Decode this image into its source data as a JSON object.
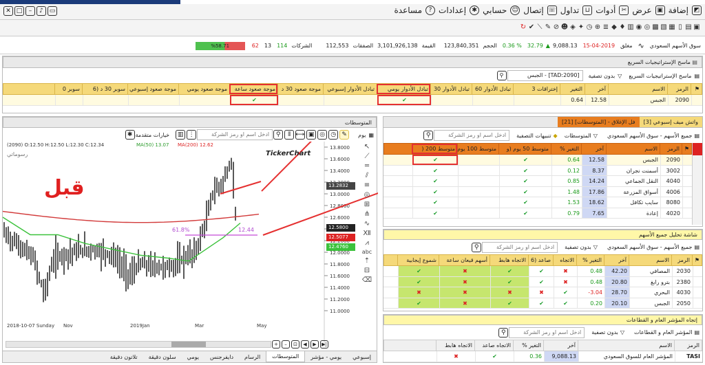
{
  "top_menu": [
    "مساعدة",
    "إعدادات",
    "حسابي",
    "إتصال",
    "تداول",
    "أدوات",
    "عرض",
    "إضافة"
  ],
  "market": {
    "name": "سوق الأسهم السعودي",
    "status": "مغلق",
    "date": "15-04-2019",
    "index": "9,088.13",
    "change": "32.79",
    "change_pct": "% 0.36",
    "volume_label": "الحجم",
    "volume": "123,840,351",
    "value_label": "القيمة",
    "value": "3,101,926,138",
    "deals_label": "الصفقات",
    "deals": "112,553",
    "companies_label": "الشركات",
    "up": "114",
    "unchanged": "13",
    "down": "62",
    "ratio": "%58.71"
  },
  "strategy": {
    "title": "ماسح الإستراتيجيات السريع",
    "scanner_btn": "ماسح الإستراتيجيات السريع",
    "filter_btn": "بدون تصفية",
    "symbol_field": "[TAD:2090] - الجبس",
    "headers": [
      "الرمز",
      "الاسم",
      "آخر",
      "التغير",
      "إختراقات 3",
      "تبادل الأدوار 60",
      "تبادل الأدوار 30",
      "تبادل الأدوار يومي",
      "تبادل الأدوار إسبوعي",
      "موجة صعود 30 د",
      "موجة صعود ساعة",
      "موجة صعود يومي",
      "موجة صعود إسبوعي",
      "سوبر 30 د (6",
      "سوبر 0"
    ],
    "row": {
      "code": "2090",
      "name": "الجبس",
      "last": "12.58",
      "change": "0.64"
    }
  },
  "chart": {
    "title": "المتوسطات",
    "period": "يوم",
    "advanced": "خيارات متقدمة",
    "search_placeholder": "ادخل اسم او رمز الشركة",
    "info": "(2090) O:12.50 H:12.50 L:12.30 C:12.34",
    "ma50": "MA(50) 13.07",
    "ma200": "MA(200) 12.62",
    "drawings": "رسوماتي",
    "brand": "TickerChart",
    "before": "قبل",
    "fib_label": "61.8%",
    "fib_value": "12.44",
    "y_ticks": [
      "13.8000",
      "13.6000",
      "13.4000",
      "13.2000",
      "13.0000",
      "12.8000",
      "12.6000",
      "12.4000",
      "12.2000",
      "12.0000",
      "11.8000",
      "11.6000",
      "11.4000",
      "11.2000",
      "11.0000"
    ],
    "price_tags": [
      "13.2832",
      "12.5800",
      "12.5077",
      "12.4760"
    ],
    "x_ticks": [
      "2018-10-07 Sunday",
      "Nov",
      "2019Jan",
      "Mar",
      "May"
    ]
  },
  "tabs": [
    "إسبوعي",
    "يومي - مؤشر",
    "المتوسطات",
    "الرسام",
    "دايفرجنس",
    "يومي",
    "سلون دقيقة",
    "تلاتون دقيقة"
  ],
  "watch": {
    "title": "واتش ميف إسبوعي [3]",
    "title2": "فل الإغلاق - [المتوسطات] [21]",
    "market_label": "جميع الأسهم - سوق الأسهم السعودي",
    "averages_btn": "المتوسطات",
    "alerts_btn": "تنبيهات التصفية",
    "search_placeholder": "ادخل اسم او رمز الشركة",
    "headers": [
      "الرمز",
      "الاسم",
      "آخر",
      "التغير %",
      "متوسط 50 يوم (و",
      "متوسط 100 يوم",
      "متوسط 200 ("
    ],
    "rows": [
      {
        "code": "2090",
        "name": "الجبس",
        "last": "12.58",
        "chg": "0.64"
      },
      {
        "code": "3002",
        "name": "أسمنت نجران",
        "last": "8.37",
        "chg": "0.12"
      },
      {
        "code": "4040",
        "name": "النقل الجماعي",
        "last": "14.24",
        "chg": "0.85"
      },
      {
        "code": "4006",
        "name": "أسواق المزرعة",
        "last": "17.86",
        "chg": "1.48"
      },
      {
        "code": "8080",
        "name": "سايب تكافل",
        "last": "18.62",
        "chg": "1.53"
      },
      {
        "code": "4020",
        "name": "إعادة",
        "last": "7.65",
        "chg": "0.79"
      }
    ]
  },
  "analysis": {
    "title": "شاشة تحليل جميع الأسهم",
    "market_label": "جميع الأسهم - سوق الأسهم السعودي",
    "filter_btn": "بدون تصفية",
    "search_placeholder": "ادخل اسم او رمز الشركة",
    "headers": [
      "الرمز",
      "الاسم",
      "آخر",
      "التغير %",
      "الاتجاه",
      "صاعد (6",
      "الاتجاه هابط",
      "أسهم قيعان ساعة",
      "شموع إيجابية"
    ],
    "rows": [
      {
        "code": "2030",
        "name": "المصافي",
        "last": "42.20",
        "chg": "0.48",
        "t1": "x",
        "t2": "v",
        "t3": "v",
        "t4": "x",
        "t5": "v"
      },
      {
        "code": "2380",
        "name": "بترو رابغ",
        "last": "20.80",
        "chg": "0.48",
        "t1": "x",
        "t2": "v",
        "t3": "v",
        "t4": "x",
        "t5": "v"
      },
      {
        "code": "4030",
        "name": "البحري",
        "last": "28.70",
        "chg": "3.04-",
        "t1": "v",
        "t2": "x",
        "t3": "x",
        "t4": "x",
        "t5": "x"
      },
      {
        "code": "2050",
        "name": "الجبس",
        "last": "20.10",
        "chg": "0.20",
        "t1": "v",
        "t2": "v",
        "t3": "v",
        "t4": "x",
        "t5": "v"
      }
    ]
  },
  "index_panel": {
    "title": "إتجاه المؤشر العام و القطاعات",
    "market_label": "المؤشر العام و القطاعات",
    "filter_btn": "بدون تصفية",
    "search_placeholder": "ادخل اسم او رمز الشركة",
    "headers": [
      "الرمز",
      "الاسم",
      "آخر",
      "التغير %",
      "الاتجاه صاعد",
      "الاتجاه هابط"
    ],
    "row": {
      "code": "TASI",
      "name": "المؤشر العام للسوق السعودي",
      "last": "9,088.13",
      "chg": "0.36"
    }
  }
}
